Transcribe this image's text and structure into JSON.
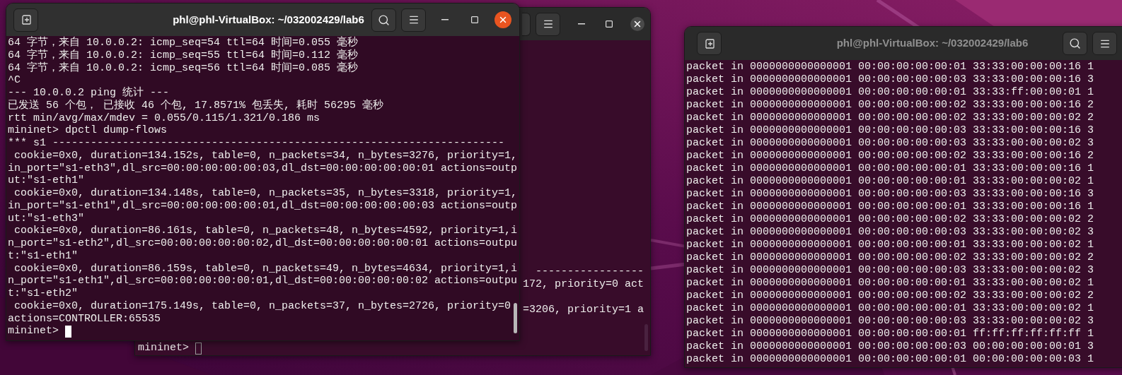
{
  "windows": [
    {
      "title": "phl@phl-VirtualBox: ~/032002429/lab6",
      "focused": true,
      "lines": [
        "64 字节，来自 10.0.0.2: icmp_seq=54 ttl=64 时间=0.055 毫秒",
        "64 字节，来自 10.0.0.2: icmp_seq=55 ttl=64 时间=0.112 毫秒",
        "64 字节，来自 10.0.0.2: icmp_seq=56 ttl=64 时间=0.085 毫秒",
        "^C",
        "--- 10.0.0.2 ping 统计 ---",
        "已发送 56 个包， 已接收 46 个包, 17.8571% 包丢失, 耗时 56295 毫秒",
        "rtt min/avg/max/mdev = 0.055/0.115/1.321/0.186 ms",
        "mininet> dpctl dump-flows",
        "*** s1 -----------------------------------------------------------------------",
        " cookie=0x0, duration=134.152s, table=0, n_packets=34, n_bytes=3276, priority=1,",
        "in_port=\"s1-eth3\",dl_src=00:00:00:00:00:03,dl_dst=00:00:00:00:00:01 actions=outp",
        "ut:\"s1-eth1\"",
        " cookie=0x0, duration=134.148s, table=0, n_packets=35, n_bytes=3318, priority=1,",
        "in_port=\"s1-eth1\",dl_src=00:00:00:00:00:01,dl_dst=00:00:00:00:00:03 actions=outp",
        "ut:\"s1-eth3\"",
        " cookie=0x0, duration=86.161s, table=0, n_packets=48, n_bytes=4592, priority=1,i",
        "n_port=\"s1-eth2\",dl_src=00:00:00:00:00:02,dl_dst=00:00:00:00:00:01 actions=outpu",
        "t:\"s1-eth1\"",
        " cookie=0x0, duration=86.159s, table=0, n_packets=49, n_bytes=4634, priority=1,i",
        "n_port=\"s1-eth1\",dl_src=00:00:00:00:00:01,dl_dst=00:00:00:00:00:02 actions=outpu",
        "t:\"s1-eth2\"",
        " cookie=0x0, duration=175.149s, table=0, n_packets=37, n_bytes=2726, priority=0",
        "actions=CONTROLLER:65535"
      ],
      "prompt": "mininet>"
    },
    {
      "focused": false,
      "lines": [
        "-----------------",
        "172, priority=0 act",
        "=3206, priority=1 a"
      ],
      "prompt": "mininet>"
    },
    {
      "title": "phl@phl-VirtualBox: ~/032002429/lab6",
      "focused": false,
      "lines": [
        "packet in 0000000000000001 00:00:00:00:00:01 33:33:00:00:00:16 1",
        "packet in 0000000000000001 00:00:00:00:00:03 33:33:00:00:00:16 3",
        "packet in 0000000000000001 00:00:00:00:00:01 33:33:ff:00:00:01 1",
        "packet in 0000000000000001 00:00:00:00:00:02 33:33:00:00:00:16 2",
        "packet in 0000000000000001 00:00:00:00:00:02 33:33:00:00:00:02 2",
        "packet in 0000000000000001 00:00:00:00:00:03 33:33:00:00:00:16 3",
        "packet in 0000000000000001 00:00:00:00:00:03 33:33:00:00:00:02 3",
        "packet in 0000000000000001 00:00:00:00:00:02 33:33:00:00:00:16 2",
        "packet in 0000000000000001 00:00:00:00:00:01 33:33:00:00:00:16 1",
        "packet in 0000000000000001 00:00:00:00:00:01 33:33:00:00:00:02 1",
        "packet in 0000000000000001 00:00:00:00:00:03 33:33:00:00:00:16 3",
        "packet in 0000000000000001 00:00:00:00:00:01 33:33:00:00:00:16 1",
        "packet in 0000000000000001 00:00:00:00:00:02 33:33:00:00:00:02 2",
        "packet in 0000000000000001 00:00:00:00:00:03 33:33:00:00:00:02 3",
        "packet in 0000000000000001 00:00:00:00:00:01 33:33:00:00:00:02 1",
        "packet in 0000000000000001 00:00:00:00:00:02 33:33:00:00:00:02 2",
        "packet in 0000000000000001 00:00:00:00:00:03 33:33:00:00:00:02 3",
        "packet in 0000000000000001 00:00:00:00:00:01 33:33:00:00:00:02 1",
        "packet in 0000000000000001 00:00:00:00:00:02 33:33:00:00:00:02 2",
        "packet in 0000000000000001 00:00:00:00:00:01 33:33:00:00:00:02 1",
        "packet in 0000000000000001 00:00:00:00:00:03 33:33:00:00:00:02 3",
        "packet in 0000000000000001 00:00:00:00:00:01 ff:ff:ff:ff:ff:ff 1",
        "packet in 0000000000000001 00:00:00:00:00:03 00:00:00:00:00:01 3",
        "packet in 0000000000000001 00:00:00:00:00:01 00:00:00:00:00:03 1"
      ]
    }
  ]
}
